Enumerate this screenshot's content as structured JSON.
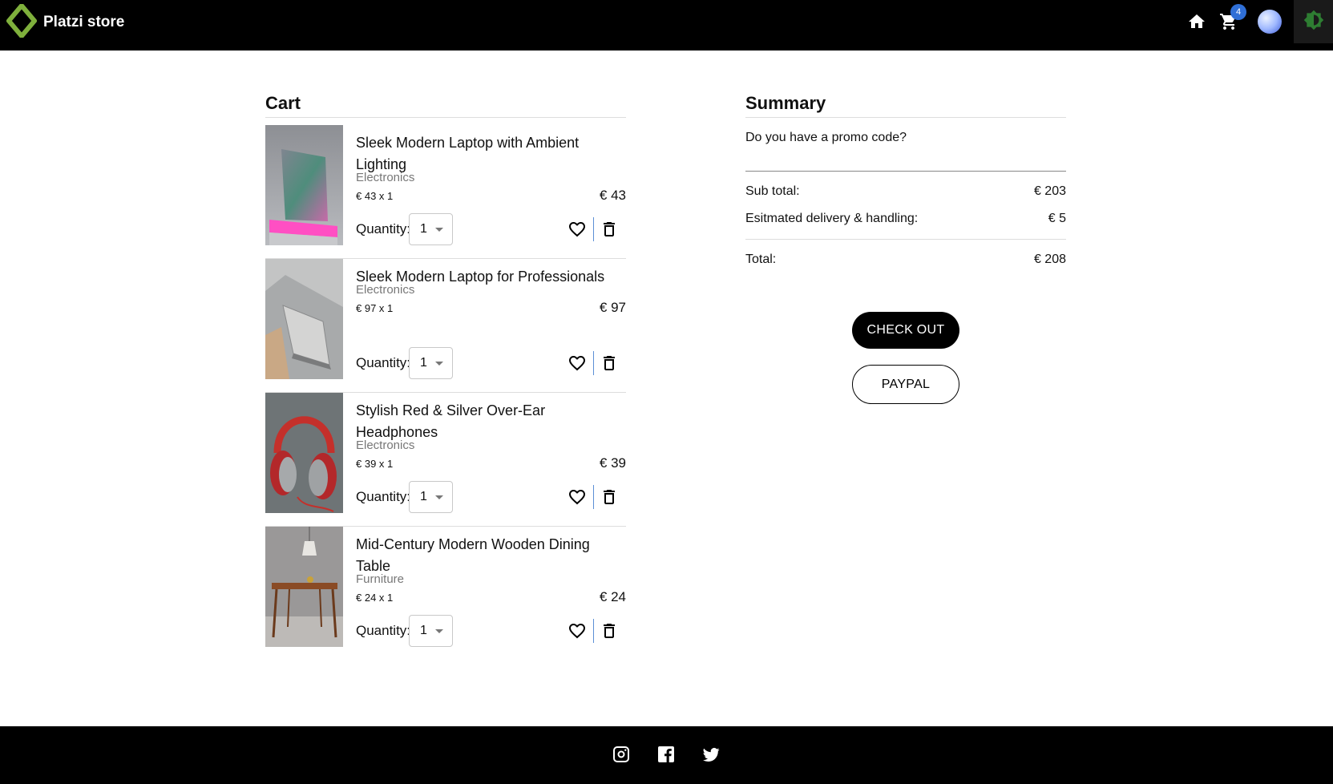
{
  "header": {
    "brand": "Platzi store",
    "cart_count": "4",
    "icons": [
      "home-icon",
      "shopping-cart-icon",
      "avatar",
      "theme-toggle-icon"
    ]
  },
  "cart": {
    "title": "Cart",
    "qty_label": "Quantity:",
    "items": [
      {
        "name": "Sleek Modern Laptop with Ambient Lighting",
        "category": "Electronics",
        "unit": "€ 43 x 1",
        "total": "€ 43",
        "qty": "1"
      },
      {
        "name": "Sleek Modern Laptop for Professionals",
        "category": "Electronics",
        "unit": "€ 97 x 1",
        "total": "€ 97",
        "qty": "1"
      },
      {
        "name": "Stylish Red & Silver Over-Ear Headphones",
        "category": "Electronics",
        "unit": "€ 39 x 1",
        "total": "€ 39",
        "qty": "1"
      },
      {
        "name": "Mid-Century Modern Wooden Dining Table",
        "category": "Furniture",
        "unit": "€ 24 x 1",
        "total": "€ 24",
        "qty": "1"
      }
    ]
  },
  "summary": {
    "title": "Summary",
    "promo_label": "Do you have a promo code?",
    "subtotal_label": "Sub total:",
    "subtotal": "€ 203",
    "delivery_label": "Esitmated delivery & handling:",
    "delivery": "€ 5",
    "total_label": "Total:",
    "total": "€ 208",
    "checkout_label": "CHECK OUT",
    "paypal_label": "PAYPAL"
  },
  "footer": {
    "icons": [
      "instagram-icon",
      "facebook-icon",
      "twitter-icon"
    ]
  },
  "colors": {
    "header_bg": "#000000",
    "badge": "#2f6fd6",
    "brand_logo": "#7fb03c",
    "divider_accent": "#5b8fd6"
  }
}
